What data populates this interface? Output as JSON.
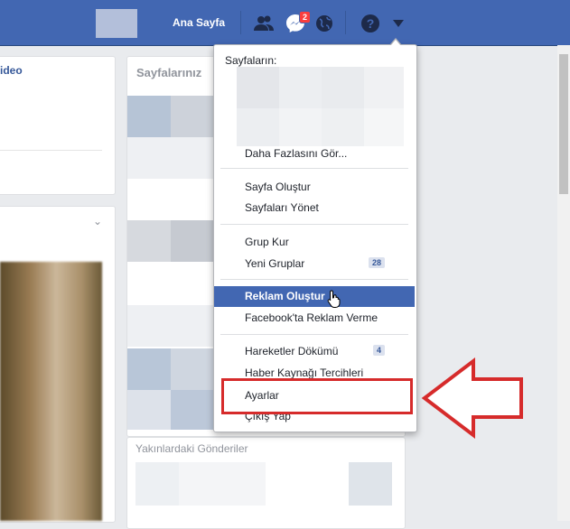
{
  "topbar": {
    "home_label": "Ana Sayfa",
    "messages_badge": "2"
  },
  "left": {
    "video_card_title": "ideo"
  },
  "pages_card": {
    "title": "Sayfalarınız"
  },
  "nearby_card": {
    "title": "Yakınlardaki Gönderiler"
  },
  "menu": {
    "pages_header": "Sayfaların:",
    "see_more": "Daha Fazlasını Gör...",
    "create_page": "Sayfa Oluştur",
    "manage_pages": "Sayfaları Yönet",
    "create_group": "Grup Kur",
    "new_groups": "Yeni Gruplar",
    "new_groups_count": "28",
    "create_ad": "Reklam Oluştur",
    "advertise": "Facebook'ta Reklam Verme",
    "activity_log": "Hareketler Dökümü",
    "activity_log_count": "4",
    "news_feed_prefs": "Haber Kaynağı Tercihleri",
    "settings": "Ayarlar",
    "logout": "Çıkış Yap"
  },
  "colors": {
    "brand": "#4267b2",
    "highlight": "#4267b2",
    "annotation": "#d62b2b"
  },
  "icons": [
    "friends-icon",
    "messenger-icon",
    "globe-icon",
    "help-icon",
    "dropdown-arrow-icon",
    "cursor-hand-icon",
    "annotation-arrow-icon"
  ]
}
